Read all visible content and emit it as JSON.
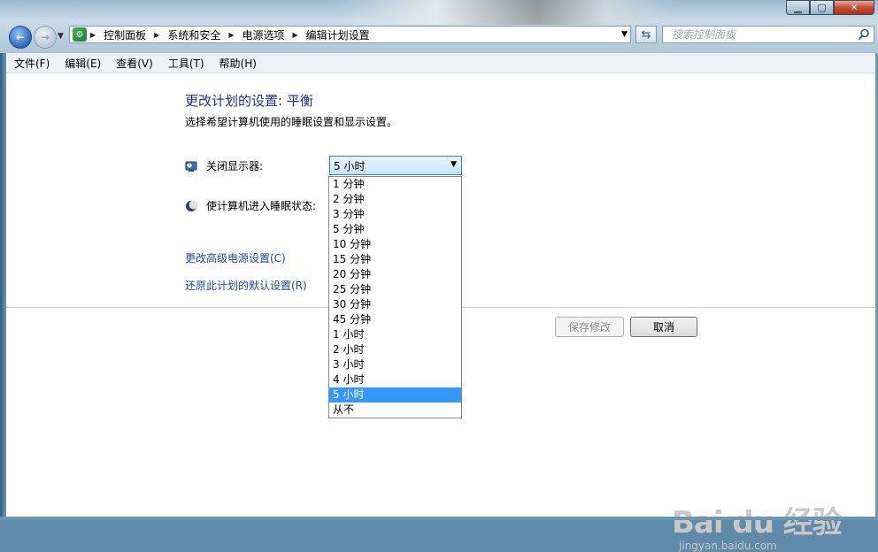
{
  "nav": {
    "breadcrumbs": [
      "控制面板",
      "系统和安全",
      "电源选项",
      "编辑计划设置"
    ],
    "search_placeholder": "搜索控制面板"
  },
  "menu": [
    "文件(F)",
    "编辑(E)",
    "查看(V)",
    "工具(T)",
    "帮助(H)"
  ],
  "page": {
    "title": "更改计划的设置: 平衡",
    "description": "选择希望计算机使用的睡眠设置和显示设置。",
    "display_off_label": "关闭显示器:",
    "sleep_label": "使计算机进入睡眠状态:",
    "display_off_value": "5 小时",
    "options": [
      "1 分钟",
      "2 分钟",
      "3 分钟",
      "5 分钟",
      "10 分钟",
      "15 分钟",
      "20 分钟",
      "25 分钟",
      "30 分钟",
      "45 分钟",
      "1 小时",
      "2 小时",
      "3 小时",
      "4 小时",
      "5 小时",
      "从不"
    ],
    "selected_index": 14,
    "link_advanced": "更改高级电源设置(C)",
    "link_restore": "还原此计划的默认设置(R)",
    "save_button": "保存修改",
    "cancel_button": "取消"
  },
  "watermark": {
    "brand": "Bai du 经验",
    "url": "jingyan.baidu.com"
  }
}
